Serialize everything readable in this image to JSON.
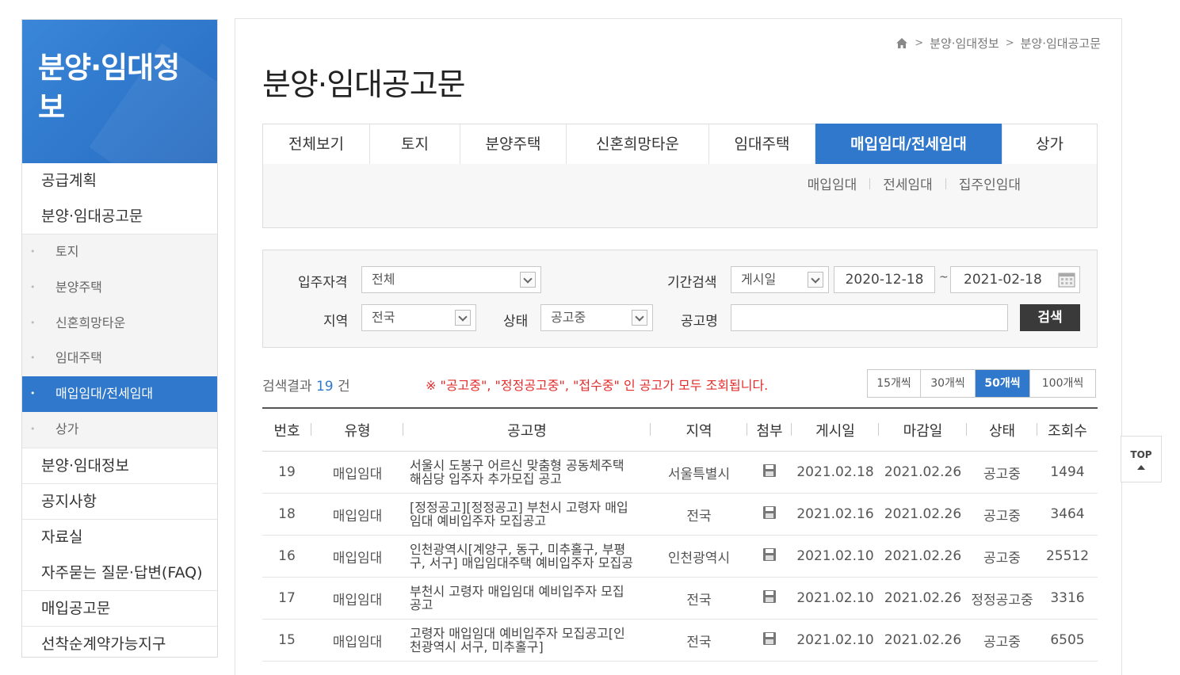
{
  "sidebar": {
    "title": "분양·임대정보",
    "items": [
      {
        "label": "공급계획"
      },
      {
        "label": "분양·임대공고문"
      }
    ],
    "subitems": [
      {
        "label": "토지"
      },
      {
        "label": "분양주택"
      },
      {
        "label": "신혼희망타운"
      },
      {
        "label": "임대주택"
      },
      {
        "label": "매입임대/전세임대"
      },
      {
        "label": "상가"
      }
    ],
    "items_after": [
      {
        "label": "분양·임대정보"
      },
      {
        "label": "공지사항"
      },
      {
        "label": "자료실"
      },
      {
        "label": "자주묻는 질문·답변(FAQ)"
      },
      {
        "label": "매입공고문"
      },
      {
        "label": "선착순계약가능지구"
      }
    ]
  },
  "breadcrumb": {
    "items": [
      "분양·임대정보",
      "분양·임대공고문"
    ]
  },
  "page": {
    "title": "분양·임대공고문"
  },
  "tabs": [
    {
      "label": "전체보기"
    },
    {
      "label": "토지"
    },
    {
      "label": "분양주택"
    },
    {
      "label": "신혼희망타운"
    },
    {
      "label": "임대주택"
    },
    {
      "label": "매입임대/전세임대"
    },
    {
      "label": "상가"
    }
  ],
  "subtabs": [
    {
      "label": "매입임대"
    },
    {
      "label": "전세임대"
    },
    {
      "label": "집주인임대"
    }
  ],
  "search": {
    "eligibility_label": "입주자격",
    "eligibility_value": "전체",
    "period_label": "기간검색",
    "period_type_value": "게시일",
    "date_from": "2020-12-18",
    "date_sep": "~",
    "date_to": "2021-02-18",
    "region_label": "지역",
    "region_value": "전국",
    "status_label": "상태",
    "status_value": "공고중",
    "notice_name_label": "공고명",
    "notice_name_value": "",
    "search_button": "검색"
  },
  "results": {
    "prefix": "검색결과",
    "count": "19",
    "suffix": "건",
    "notice": "※ \"공고중\", \"정정공고중\", \"접수중\" 인 공고가 모두 조회됩니다."
  },
  "per_page": [
    {
      "label": "15개씩"
    },
    {
      "label": "30개씩"
    },
    {
      "label": "50개씩"
    },
    {
      "label": "100개씩"
    }
  ],
  "table": {
    "headers": [
      "번호",
      "유형",
      "공고명",
      "지역",
      "첨부",
      "게시일",
      "마감일",
      "상태",
      "조회수"
    ],
    "rows": [
      {
        "no": "19",
        "type": "매입임대",
        "title_l1": "서울시 도봉구 어르신 맞춤형 공동체주택",
        "title_l2": "해심당 입주자 추가모집 공고",
        "region": "서울특별시",
        "post": "2021.02.18",
        "due": "2021.02.26",
        "status": "공고중",
        "views": "1494"
      },
      {
        "no": "18",
        "type": "매입임대",
        "title_l1": "[정정공고][정정공고] 부천시 고령자 매입",
        "title_l2": "임대 예비입주자 모집공고",
        "region": "전국",
        "post": "2021.02.16",
        "due": "2021.02.26",
        "status": "공고중",
        "views": "3464"
      },
      {
        "no": "16",
        "type": "매입임대",
        "title_l1": "인천광역시[계양구, 동구, 미추홀구, 부평",
        "title_l2": "구, 서구] 매입임대주택 예비입주자 모집공",
        "region": "인천광역시",
        "post": "2021.02.10",
        "due": "2021.02.26",
        "status": "공고중",
        "views": "25512"
      },
      {
        "no": "17",
        "type": "매입임대",
        "title_l1": "부천시 고령자 매입임대 예비입주자 모집",
        "title_l2": "공고",
        "region": "전국",
        "post": "2021.02.10",
        "due": "2021.02.26",
        "status": "정정공고중",
        "views": "3316"
      },
      {
        "no": "15",
        "type": "매입임대",
        "title_l1": "고령자 매입임대 예비입주자 모집공고[인",
        "title_l2": "천광역시 서구, 미추홀구]",
        "region": "전국",
        "post": "2021.02.10",
        "due": "2021.02.26",
        "status": "공고중",
        "views": "6505"
      }
    ]
  },
  "top_button": {
    "label": "TOP"
  },
  "colors": {
    "accent": "#2f78cc",
    "notice": "#e32b2b",
    "button_dark": "#3a3a3a"
  }
}
